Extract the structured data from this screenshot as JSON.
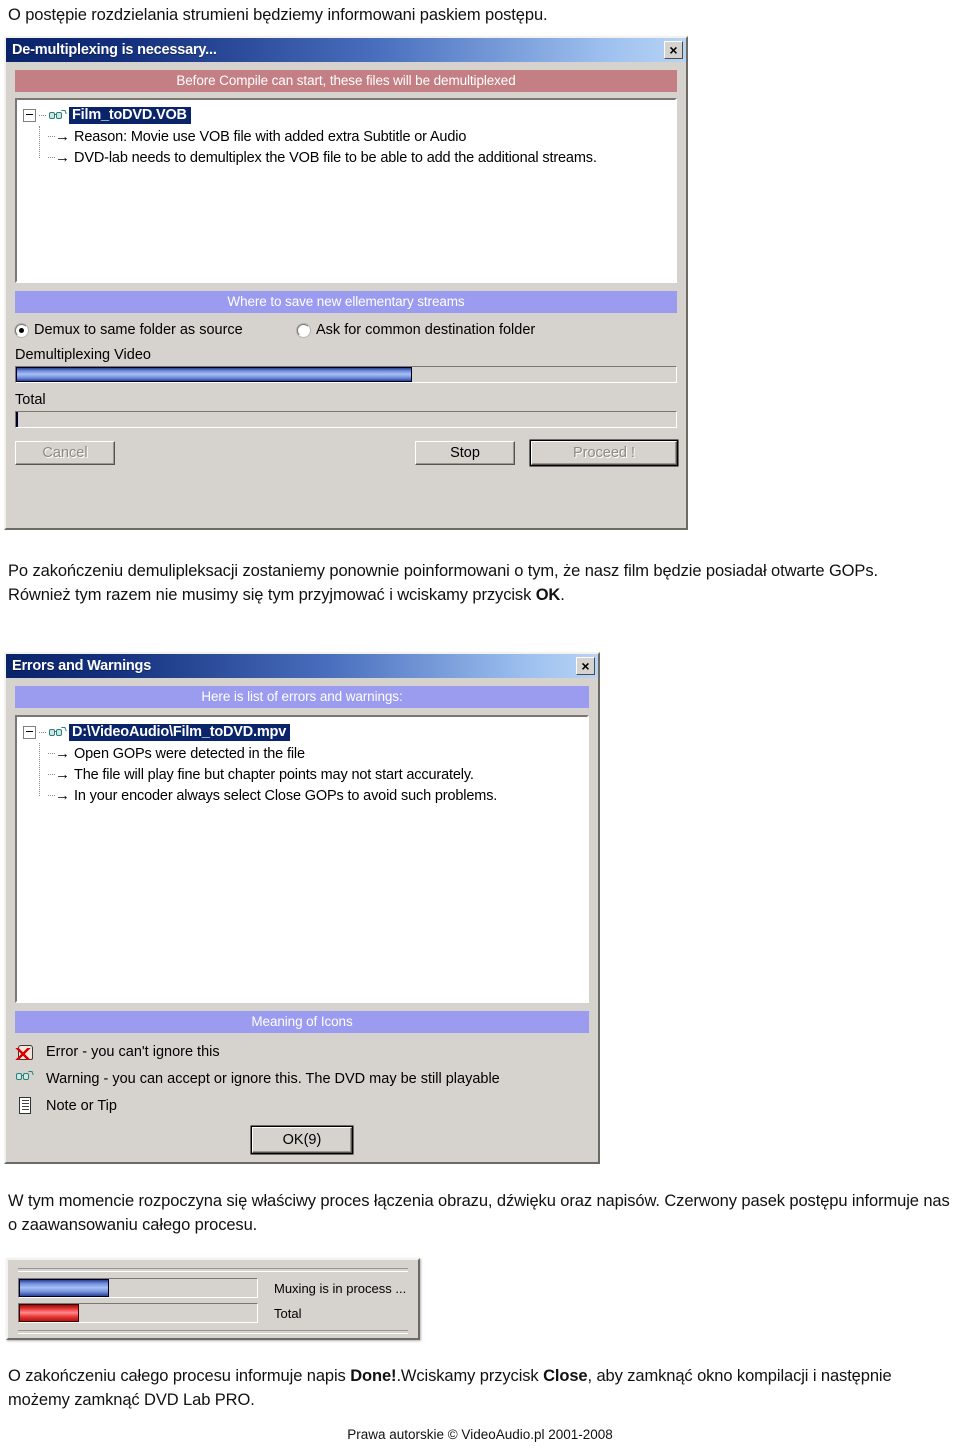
{
  "intro_paragraph": "O postępie rozdzielania strumieni będziemy informowani paskiem postępu.",
  "middle_paragraph_1": "Po zakończeniu demulipleksacji zostaniemy ponownie poinformowani o tym, że nasz film będzie posiadał otwarte GOPs. Również tym razem nie musimy się tym przyjmować i wciskamy przycisk ",
  "middle_paragraph_ok": "OK",
  "middle_paragraph_end": ".",
  "muxing_paragraph": "W tym momencie rozpoczyna się właściwy proces łączenia obrazu, dźwięku oraz napisów. Czerwony pasek postępu informuje nas o zaawansowaniu całego procesu.",
  "final_paragraph_1": "O zakończeniu całego procesu informuje napis ",
  "final_paragraph_done": "Done!",
  "final_paragraph_2": ".Wciskamy przycisk ",
  "final_paragraph_close": "Close",
  "final_paragraph_3": ", aby zamknąć okno kompilacji i następnie możemy zamknąć DVD Lab PRO.",
  "footer": "Prawa autorskie © VideoAudio.pl 2001-2008",
  "demux_dialog": {
    "title": "De-multiplexing is necessary...",
    "close_label": "×",
    "banner_red": "Before Compile can start, these files will be demultiplexed",
    "tree": {
      "root_label": "Film_toDVD.VOB",
      "root_icon": "glasses-warning-icon",
      "children": [
        "Reason: Movie use VOB file with added extra Subtitle or Audio",
        "DVD-lab needs to demultiplex the VOB file to be able to add the additional streams."
      ]
    },
    "banner_purple": "Where to save new ellementary streams",
    "radios": [
      {
        "label": "Demux to same folder as source",
        "selected": true
      },
      {
        "label": "Ask for common destination folder",
        "selected": false
      }
    ],
    "progress": [
      {
        "label": "Demultiplexing Video",
        "percent": 60,
        "color": "#4a6fbe"
      },
      {
        "label": "Total",
        "percent": 0,
        "color": "#4a6fbe"
      }
    ],
    "buttons": [
      {
        "label": "Cancel",
        "state": "disabled"
      },
      {
        "label": "Stop",
        "state": "enabled"
      },
      {
        "label": "Proceed !",
        "state": "disabled-default"
      }
    ]
  },
  "errors_dialog": {
    "title": "Errors and Warnings",
    "close_label": "×",
    "banner_purple_top": "Here is list of errors and warnings:",
    "tree": {
      "root_label": "D:\\VideoAudio\\Film_toDVD.mpv",
      "root_icon": "glasses-warning-icon",
      "children": [
        "Open GOPs were detected in the file",
        "The file will play fine but chapter points may not start accurately.",
        "In your encoder always select Close GOPs to avoid such problems."
      ]
    },
    "banner_purple_bottom": "Meaning of Icons",
    "legend": [
      {
        "icon": "error-hand-icon",
        "label": "Error - you can't ignore this"
      },
      {
        "icon": "glasses-warning-icon",
        "label": "Warning - you can accept or ignore this. The DVD may be still playable"
      },
      {
        "icon": "note-document-icon",
        "label": "Note or Tip"
      }
    ],
    "ok_button": "OK(9)"
  },
  "mux_panel": {
    "rows": [
      {
        "label": "Muxing is in process ...",
        "percent": 38,
        "color": "#3b5fc0"
      },
      {
        "label": "Total",
        "percent": 25,
        "color": "#e02020"
      }
    ]
  }
}
